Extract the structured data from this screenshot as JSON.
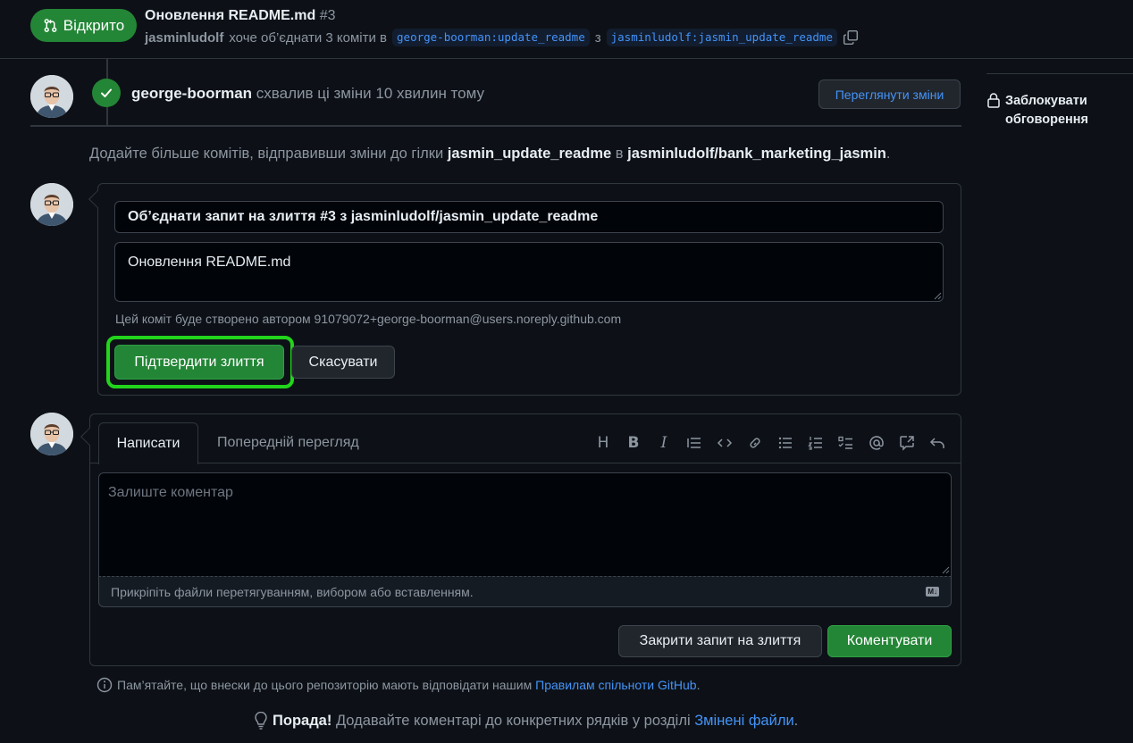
{
  "header": {
    "state_label": "Відкрито",
    "title": "Оновлення README.md",
    "number": "#3",
    "author": "jasminludolf",
    "merge_text": "хоче об’єднати 3 коміти в",
    "base_branch": "george-boorman:update_readme",
    "from_word": "з",
    "head_branch": "jasminludolf:jasmin_update_readme"
  },
  "sidebar": {
    "lock_label_line1": "Заблокувати",
    "lock_label_line2": "обговорення"
  },
  "timeline": {
    "reviewer": "george-boorman",
    "approval_text": "схвалив ці зміни 10 хвилин тому",
    "view_changes_label": "Переглянути зміни",
    "add_commits_prefix": "Додайте більше комітів, відправивши зміни до гілки",
    "add_commits_branch": "jasmin_update_readme",
    "add_commits_in": "в",
    "add_commits_repo": "jasminludolf/bank_marketing_jasmin",
    "add_commits_suffix": "."
  },
  "merge": {
    "commit_title": "Об’єднати запит на злиття #3 з jasminludolf/jasmin_update_readme",
    "commit_body": "Оновлення README.md",
    "author_note": "Цей коміт буде створено автором 91079072+george-boorman@users.noreply.github.com",
    "confirm_label": "Підтвердити злиття",
    "cancel_label": "Скасувати"
  },
  "comment": {
    "tab_write": "Написати",
    "tab_preview": "Попередній перегляд",
    "placeholder": "Залиште коментар",
    "attach_hint": "Прикріпіть файли перетягуванням, вибором або вставленням.",
    "md_badge": "M↓",
    "close_pr_label": "Закрити запит на злиття",
    "comment_label": "Коментувати",
    "toolbar": {
      "heading": "H",
      "bold": "B",
      "italic": "I"
    }
  },
  "footer": {
    "guidelines_prefix": "Пам’ятайте, що внески до цього репозиторію мають відповідати нашим",
    "guidelines_link": "Правилам спільноти GitHub",
    "guidelines_suffix": ".",
    "protip_bold": "Порада!",
    "protip_text": "Додавайте коментарі до конкретних рядків у розділі",
    "protip_link": "Змінені файли",
    "protip_suffix": "."
  },
  "colors": {
    "background": "#0d1117",
    "success": "#238636",
    "link": "#4493f8",
    "highlight": "#22d41c"
  }
}
